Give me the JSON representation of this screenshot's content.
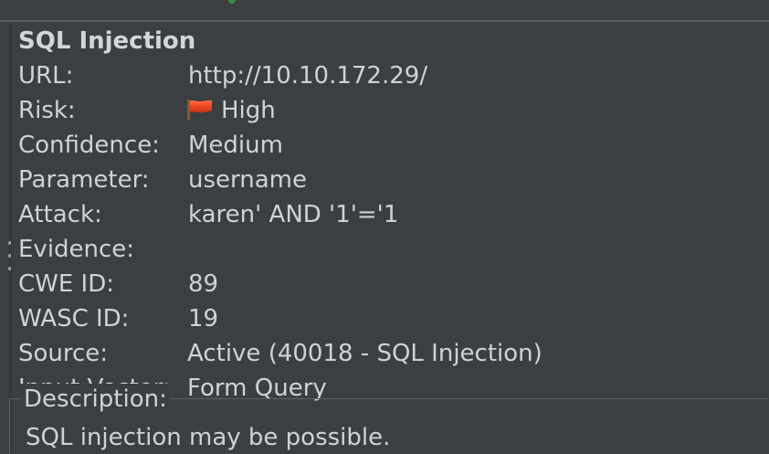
{
  "alert": {
    "title": "SQL Injection",
    "fields": [
      {
        "label": "URL:",
        "value": "http://10.10.172.29/"
      },
      {
        "label": "Risk:",
        "value": "High",
        "icon": "red-flag-icon"
      },
      {
        "label": "Confidence:",
        "value": "Medium"
      },
      {
        "label": "Parameter:",
        "value": "username"
      },
      {
        "label": "Attack:",
        "value": "karen' AND '1'='1"
      },
      {
        "label": "Evidence:",
        "value": ""
      },
      {
        "label": "CWE ID:",
        "value": "89"
      },
      {
        "label": "WASC ID:",
        "value": "19"
      },
      {
        "label": "Source:",
        "value": "Active (40018 - SQL Injection)"
      },
      {
        "label": "Input Vector:",
        "value": "Form Query"
      }
    ],
    "description": {
      "legend": "Description:",
      "text": "SQL injection may be possible."
    }
  },
  "colors": {
    "background": "#3c3f41",
    "text": "#cfd3d7",
    "risk_flag": "#e2401f"
  }
}
